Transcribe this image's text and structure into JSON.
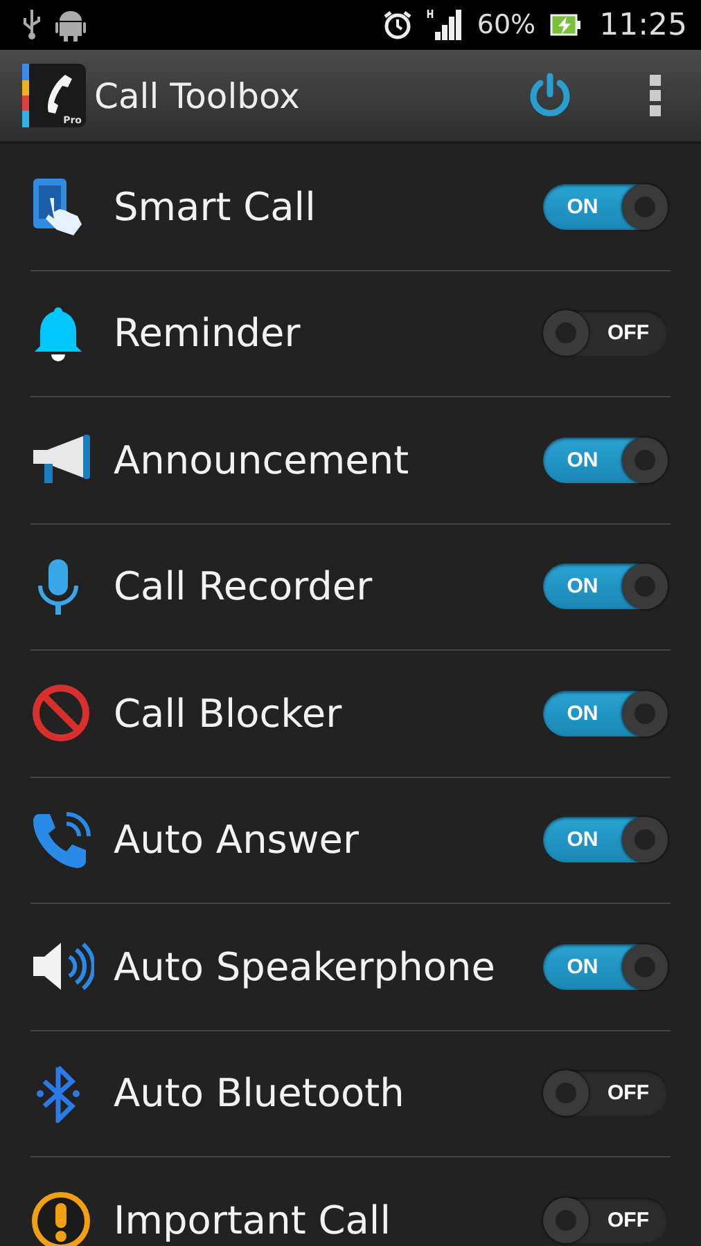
{
  "status_bar": {
    "battery": "60%",
    "time": "11:25"
  },
  "app_bar": {
    "title": "Call Toolbox",
    "badge": "Pro"
  },
  "features": [
    {
      "label": "Smart Call",
      "on": true,
      "switch_label": "ON"
    },
    {
      "label": "Reminder",
      "on": false,
      "switch_label": "OFF"
    },
    {
      "label": "Announcement",
      "on": true,
      "switch_label": "ON"
    },
    {
      "label": "Call Recorder",
      "on": true,
      "switch_label": "ON"
    },
    {
      "label": "Call Blocker",
      "on": true,
      "switch_label": "ON"
    },
    {
      "label": "Auto Answer",
      "on": true,
      "switch_label": "ON"
    },
    {
      "label": "Auto Speakerphone",
      "on": true,
      "switch_label": "ON"
    },
    {
      "label": "Auto Bluetooth",
      "on": false,
      "switch_label": "OFF"
    },
    {
      "label": "Important Call",
      "on": false,
      "switch_label": "OFF"
    }
  ]
}
